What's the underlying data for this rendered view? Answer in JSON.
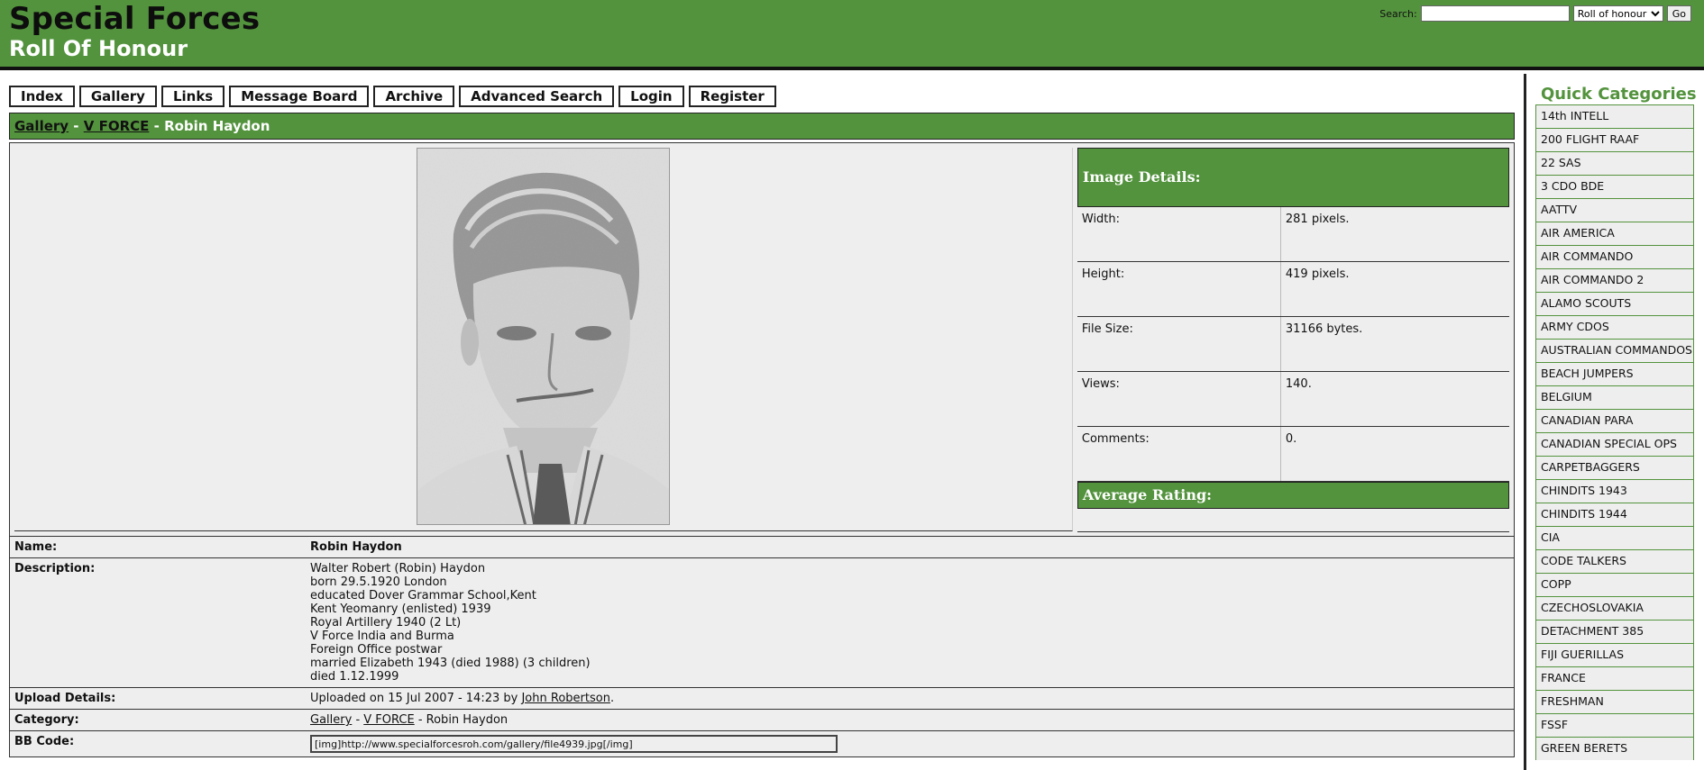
{
  "header": {
    "title": "Special Forces",
    "subtitle": "Roll Of Honour",
    "search_label": "Search:",
    "search_value": "",
    "search_scope": "Roll of honour",
    "search_go": "Go"
  },
  "nav": [
    "Index",
    "Gallery",
    "Links",
    "Message Board",
    "Archive",
    "Advanced Search",
    "Login",
    "Register"
  ],
  "breadcrumb": {
    "gallery": "Gallery",
    "sep1": " - ",
    "category": "V FORCE",
    "sep2": " - ",
    "current": "Robin Haydon"
  },
  "details": {
    "title": "Image Details:",
    "rows": [
      {
        "label": "Width:",
        "value": "281 pixels."
      },
      {
        "label": "Height:",
        "value": "419 pixels."
      },
      {
        "label": "File Size:",
        "value": "31166 bytes."
      },
      {
        "label": "Views:",
        "value": "140."
      },
      {
        "label": "Comments:",
        "value": "0."
      }
    ],
    "rating_title": "Average Rating:"
  },
  "info": {
    "name_label": "Name:",
    "name": "Robin Haydon",
    "description_label": "Description:",
    "description": [
      "Walter Robert (Robin) Haydon",
      "born 29.5.1920 London",
      "educated Dover Grammar School,Kent",
      "Kent Yeomanry (enlisted) 1939",
      "Royal Artillery 1940 (2 Lt)",
      "V Force India and Burma",
      "Foreign Office postwar",
      "married Elizabeth 1943 (died 1988) (3 children)",
      "died 1.12.1999"
    ],
    "upload_label": "Upload Details:",
    "upload_prefix": "Uploaded on 15 Jul 2007 - 14:23 by ",
    "upload_user": "John Robertson",
    "upload_suffix": ".",
    "category_label": "Category:",
    "category_gallery": "Gallery",
    "category_sep1": " - ",
    "category_name": "V FORCE",
    "category_sep2": " - Robin Haydon",
    "bbcode_label": "BB Code:",
    "bbcode": "[img]http://www.specialforcesroh.com/gallery/file4939.jpg[/img]"
  },
  "sidebar": {
    "title": "Quick Categories",
    "items": [
      "14th INTELL",
      "200 FLIGHT RAAF",
      "22 SAS",
      "3 CDO BDE",
      "AATTV",
      "AIR AMERICA",
      "AIR COMMANDO",
      "AIR COMMANDO 2",
      "ALAMO SCOUTS",
      "ARMY CDOS",
      "AUSTRALIAN COMMANDOS",
      "BEACH JUMPERS",
      "BELGIUM",
      "CANADIAN PARA",
      "CANADIAN SPECIAL OPS",
      "CARPETBAGGERS",
      "CHINDITS 1943",
      "CHINDITS 1944",
      "CIA",
      "CODE TALKERS",
      "COPP",
      "CZECHOSLOVAKIA",
      "DETACHMENT 385",
      "FIJI GUERILLAS",
      "FRANCE",
      "FRESHMAN",
      "FSSF",
      "GREEN BERETS"
    ]
  },
  "colors": {
    "accent": "#53933d",
    "panel": "#eeeeee"
  }
}
